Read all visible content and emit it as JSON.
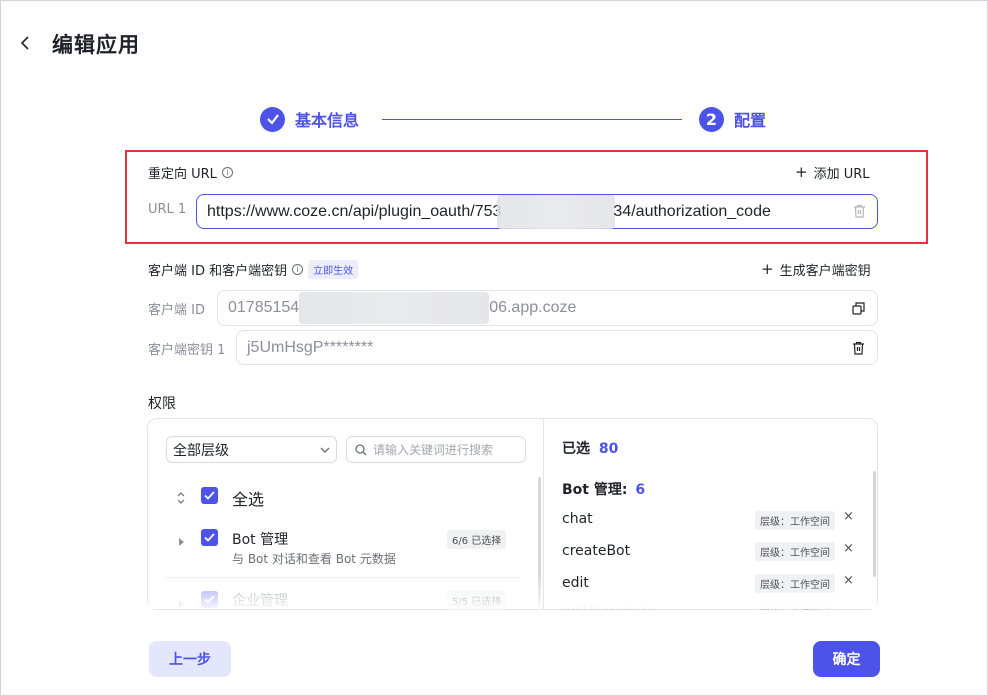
{
  "header": {
    "title": "编辑应用",
    "back_icon": "chevron-left-icon"
  },
  "steps": [
    {
      "label": "基本信息",
      "status": "done"
    },
    {
      "number": "2",
      "label": "配置",
      "status": "active"
    }
  ],
  "redirect": {
    "label": "重定向 URL",
    "add_label": "添加 URL",
    "url_row_label": "URL 1",
    "url_prefix": "https://www.coze.cn/api/plugin_oauth/753",
    "url_suffix": "34/authorization_code"
  },
  "client": {
    "label": "客户端 ID 和客户端密钥",
    "badge": "立即生效",
    "generate_label": "生成客户端密钥",
    "id_label": "客户端 ID",
    "id_prefix": "01785154",
    "id_suffix": "06.app.coze",
    "secret_label": "客户端密钥 1",
    "secret_value": "j5UmHsgP********"
  },
  "permissions": {
    "label": "权限",
    "level_select": "全部层级",
    "search_placeholder": "请输入关键词进行搜索",
    "select_all": "全选",
    "groups": [
      {
        "title": "Bot 管理",
        "subtitle": "与 Bot 对话和查看 Bot 元数据",
        "count": "6/6 已选择"
      },
      {
        "title": "企业管理",
        "count": "5/5 已选择"
      }
    ],
    "selected": {
      "label": "已选",
      "count": "80",
      "group_title": "Bot 管理:",
      "group_count": "6",
      "items": [
        {
          "name": "chat",
          "tag": "层级：工作空间"
        },
        {
          "name": "createBot",
          "tag": "层级：工作空间"
        },
        {
          "name": "edit",
          "tag": "层级：工作空间"
        },
        {
          "name": "editMetadata",
          "tag": "层级：工作空间"
        }
      ]
    }
  },
  "footer": {
    "prev_label": "上一步",
    "confirm_label": "确定"
  },
  "colors": {
    "accent": "#4d53e8",
    "highlight_border": "#e03240"
  }
}
